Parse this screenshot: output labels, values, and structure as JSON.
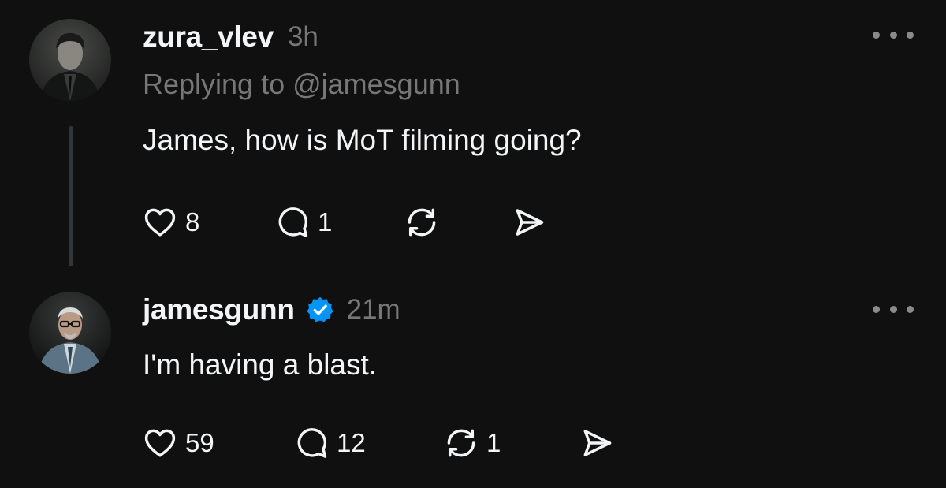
{
  "posts": [
    {
      "username": "zura_vlev",
      "time": "3h",
      "reply_to": "Replying to @jamesgunn",
      "text": "James, how is MoT filming going?",
      "verified": false,
      "actions": {
        "like_count": "8",
        "comment_count": "1",
        "repost_count": "",
        "share_count": ""
      }
    },
    {
      "username": "jamesgunn",
      "time": "21m",
      "text": "I'm having a blast.",
      "verified": true,
      "actions": {
        "like_count": "59",
        "comment_count": "12",
        "repost_count": "1",
        "share_count": ""
      }
    }
  ],
  "icons": {
    "like": "heart-icon",
    "comment": "comment-bubble-icon",
    "repost": "repost-icon",
    "share": "send-icon",
    "more": "more-options-icon",
    "verified": "verified-badge-icon"
  },
  "colors": {
    "background": "#101010",
    "text_primary": "#f3f5f7",
    "text_secondary": "#777777",
    "thread_line": "#333638",
    "verified_blue": "#0095f6"
  }
}
